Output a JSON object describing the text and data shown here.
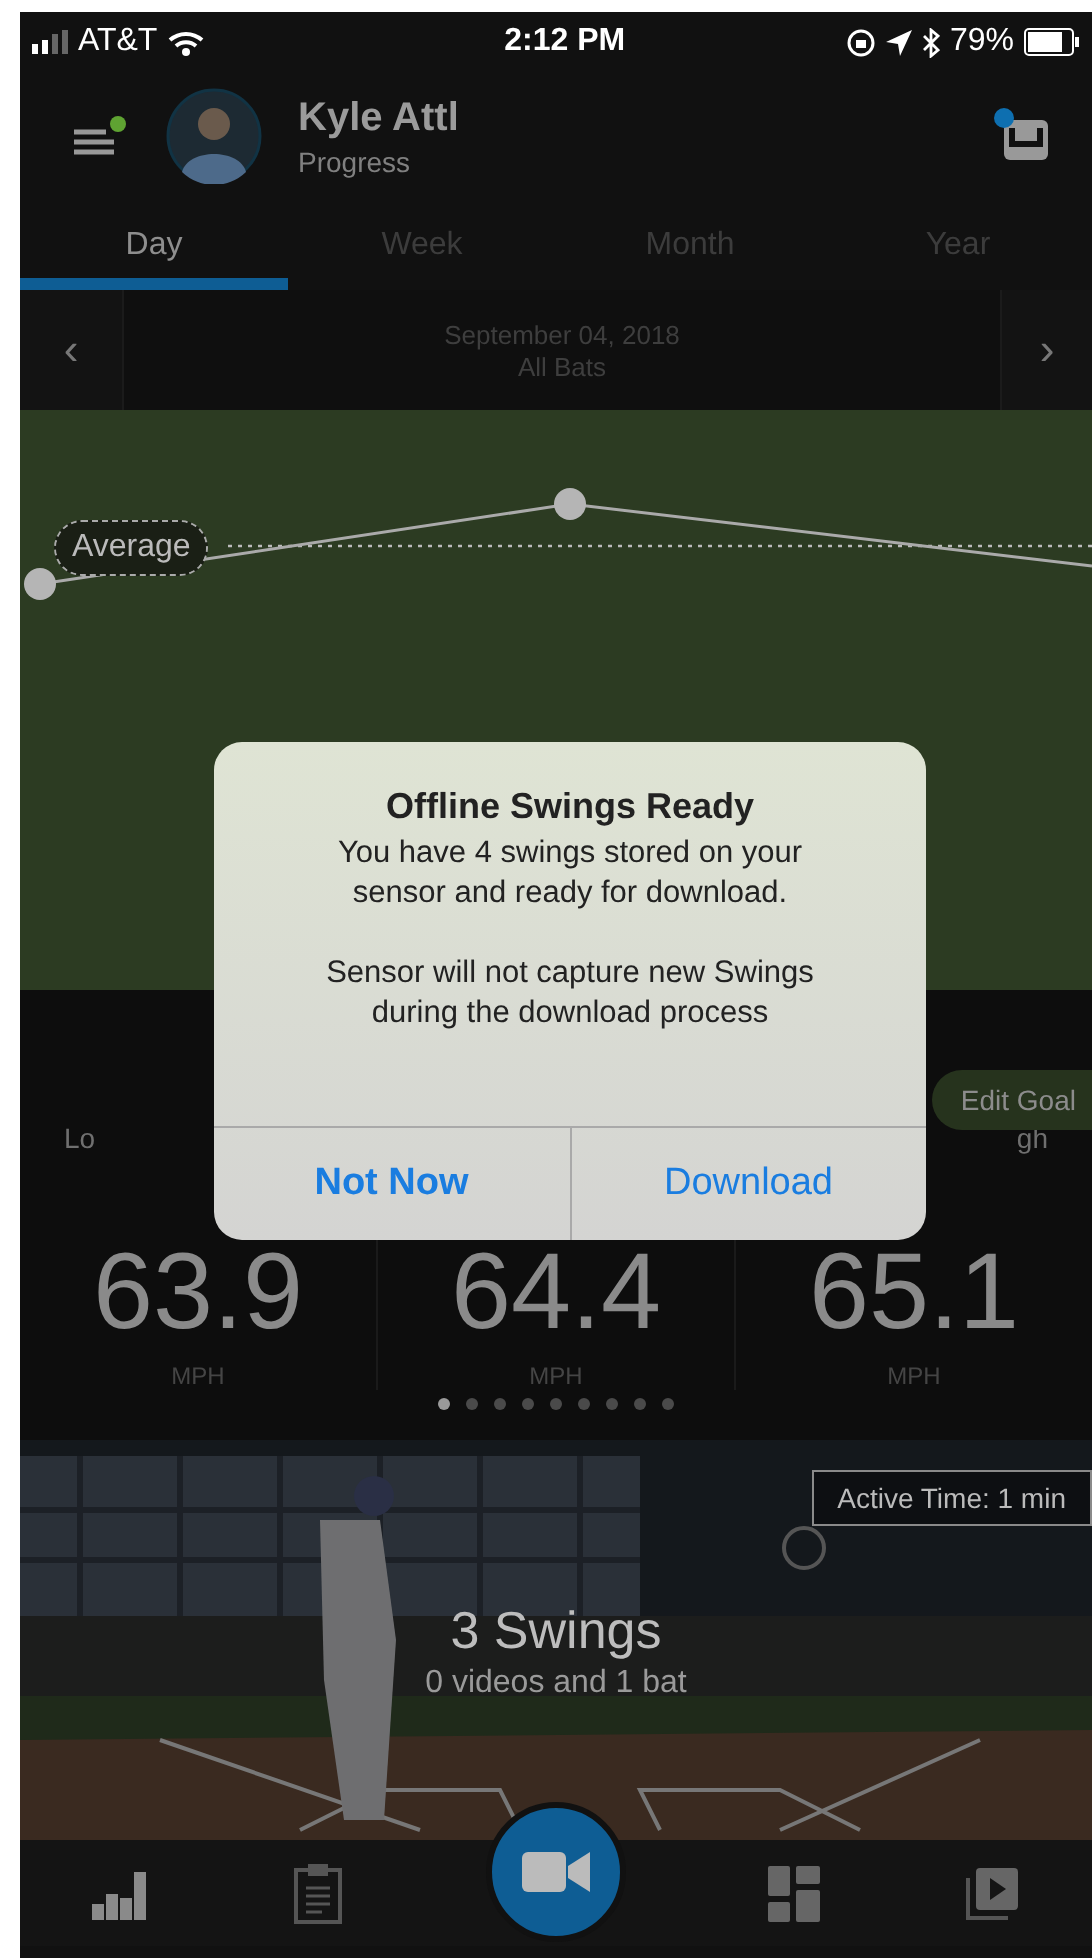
{
  "status_bar": {
    "carrier": "AT&T",
    "time": "2:12 PM",
    "battery": "79%"
  },
  "header": {
    "name": "Kyle Attl",
    "subtitle": "Progress",
    "menu_badge": true,
    "inbox_badge": true
  },
  "tabs": [
    {
      "label": "Day",
      "selected": true
    },
    {
      "label": "Week",
      "selected": false
    },
    {
      "label": "Month",
      "selected": false
    },
    {
      "label": "Year",
      "selected": false
    }
  ],
  "date_nav": {
    "previous": "‹",
    "date": "September 04, 2018",
    "bats": "All Bats",
    "next": "›"
  },
  "chart": {
    "average_label": "Average"
  },
  "goal_button": "Edit Goal",
  "stats": [
    {
      "label": "Lo",
      "value": "63.9",
      "unit": "MPH"
    },
    {
      "value": "64.4",
      "unit": "MPH"
    },
    {
      "label": "gh",
      "value": "65.1",
      "unit": "MPH"
    }
  ],
  "page_dots": [
    {
      "selected": true
    },
    {
      "selected": false
    },
    {
      "selected": false
    },
    {
      "selected": false
    },
    {
      "selected": false
    },
    {
      "selected": false
    },
    {
      "selected": false
    },
    {
      "selected": false
    },
    {
      "selected": false
    }
  ],
  "session": {
    "kind": "picture",
    "active_time": "Active Time: 1 min",
    "title": "3 Swings",
    "subtitle": "0 videos and 1 bat"
  },
  "bottom_nav": [
    {
      "kind": "stats"
    },
    {
      "kind": "clipboard"
    },
    {
      "kind": "camera"
    },
    {
      "kind": "grid"
    },
    {
      "kind": "video"
    }
  ],
  "dialog": {
    "title": "Offline Swings Ready",
    "message": "You have 4 swings stored on your sensor and ready for download.",
    "note": "Sensor will not capture new Swings during the download process",
    "buttons": [
      {
        "label": "Not Now",
        "kind": "primary"
      },
      {
        "label": "Download",
        "kind": "default"
      }
    ]
  }
}
